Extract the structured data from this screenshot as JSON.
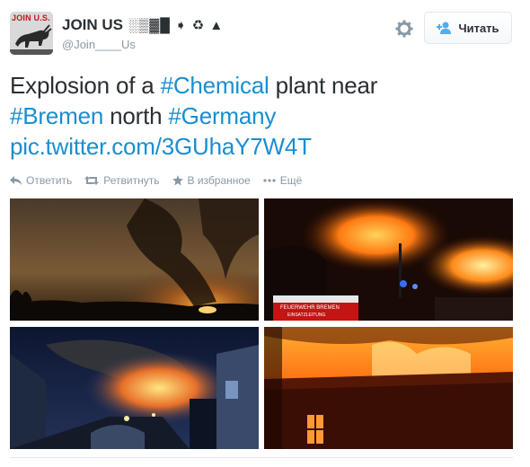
{
  "user": {
    "avatar_text": "JOIN U.S.",
    "display_name": "JOIN US",
    "name_glyphs": "░▒▓█ ➧ ♻ ▲",
    "handle": "@Join____Us"
  },
  "follow_button": {
    "label": "Читать"
  },
  "tweet": {
    "part1": "Explosion of a ",
    "hashtag1": "#Chemical",
    "part2": " plant near ",
    "hashtag2": "#Bremen",
    "part3": " north ",
    "hashtag3": "#Germany",
    "link": "pic.twitter.com/3GUhaY7W4T"
  },
  "actions": {
    "reply": "Ответить",
    "retweet": "Ретвитнуть",
    "favorite": "В избранное",
    "more": "Ещё"
  },
  "media": {
    "truck_text_line1": "FEUERWEHR BREMEN",
    "truck_text_line2": "EINSATZLEITUNG"
  },
  "colors": {
    "link": "#1a8ecf",
    "text": "#292f33",
    "muted": "#8899a6",
    "fire": "#ff7a12"
  }
}
